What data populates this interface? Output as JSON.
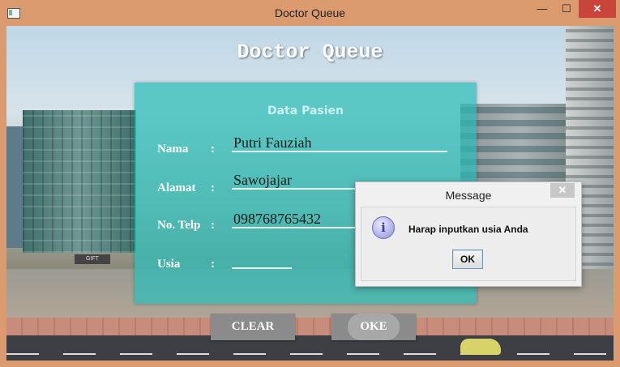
{
  "window": {
    "title": "Doctor Queue",
    "minimize_glyph": "—",
    "maximize_glyph": "☐",
    "close_glyph": "✕"
  },
  "app": {
    "title": "Doctor Queue",
    "background_sign": "GIFT"
  },
  "form": {
    "section_title": "Data Pasien",
    "fields": [
      {
        "label": "Nama",
        "colon": ":",
        "value": "Putri Fauziah"
      },
      {
        "label": "Alamat",
        "colon": ":",
        "value": "Sawojajar"
      },
      {
        "label": "No. Telp",
        "colon": ":",
        "value": "098768765432"
      },
      {
        "label": "Usia",
        "colon": ":",
        "value": ""
      }
    ]
  },
  "buttons": {
    "clear": "CLEAR",
    "oke": "OKE"
  },
  "dialog": {
    "title": "Message",
    "close_glyph": "✕",
    "icon": "info-icon",
    "icon_glyph": "i",
    "message": "Harap inputkan usia Anda",
    "ok": "OK"
  },
  "colors": {
    "window_frame": "#dc9a6f",
    "close_button": "#c9453a",
    "panel": "#2cbeb9",
    "button": "#8b8b8b"
  }
}
